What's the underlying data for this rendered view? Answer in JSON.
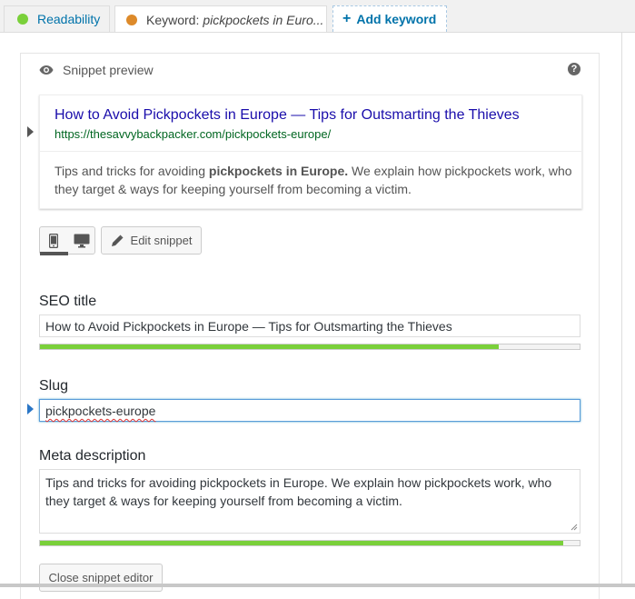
{
  "tabs": {
    "readability": {
      "label": "Readability",
      "status_color": "#7ad03a"
    },
    "keyword": {
      "label": "Keyword:",
      "value": "pickpockets in Euro...",
      "status_color": "#dd8a2a"
    },
    "add_keyword": {
      "icon": "plus-icon",
      "label": "Add keyword"
    }
  },
  "snippet": {
    "heading": "Snippet preview",
    "heading_icon": "eye-icon",
    "help_icon": "question-icon",
    "help_glyph": "?",
    "preview": {
      "title": "How to Avoid Pickpockets in Europe — Tips for Outsmarting the Thieves",
      "url": "https://thesavvybackpacker.com/pickpockets-europe/",
      "desc_prefix": "Tips and tricks for avoiding ",
      "desc_bold": "pickpockets in Europe.",
      "desc_suffix": " We explain how pickpockets work, who they target & ways for keeping yourself from becoming a victim."
    },
    "modes": {
      "mobile_icon": "mobile-icon",
      "desktop_icon": "desktop-icon",
      "active": "mobile"
    },
    "edit_button": {
      "icon": "pencil-icon",
      "label": "Edit snippet"
    }
  },
  "form": {
    "seo_title": {
      "label": "SEO title",
      "value": "How to Avoid Pickpockets in Europe — Tips for Outsmarting the Thieves",
      "progress": 0.85,
      "progress_color": "#7ad03a"
    },
    "slug": {
      "label": "Slug",
      "value": "pickpockets-europe"
    },
    "meta_description": {
      "label": "Meta description",
      "value": "Tips and tricks for avoiding pickpockets in Europe. We explain how pickpockets work, who they target & ways for keeping yourself from becoming a victim.",
      "progress": 0.97,
      "progress_color": "#7ad03a"
    }
  },
  "close_button": {
    "label": "Close snippet editor"
  }
}
